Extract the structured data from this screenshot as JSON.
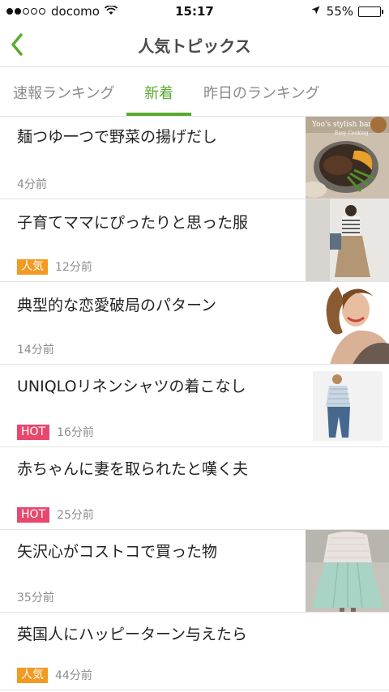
{
  "status_bar": {
    "carrier": "docomo",
    "time": "15:17",
    "battery": "55%",
    "battery_level": 0.55
  },
  "nav": {
    "title": "人気トピックス"
  },
  "tabs": [
    {
      "label": "速報ランキング",
      "active": false
    },
    {
      "label": "新着",
      "active": true
    },
    {
      "label": "昨日のランキング",
      "active": false
    }
  ],
  "items": [
    {
      "title": "麺つゆ一つで野菜の揚げだし",
      "badge": "",
      "time": "4分前",
      "thumb_text": {
        "line1": "Yoo's stylish bar",
        "line2": "Easy Cooking"
      }
    },
    {
      "title": "子育てママにぴったりと思った服",
      "badge": "人気",
      "time": "12分前"
    },
    {
      "title": "典型的な恋愛破局のパターン",
      "badge": "",
      "time": "14分前"
    },
    {
      "title": "UNIQLOリネンシャツの着こなし",
      "badge": "HOT",
      "time": "16分前"
    },
    {
      "title": "赤ちゃんに妻を取られたと嘆く夫",
      "badge": "HOT",
      "time": "25分前"
    },
    {
      "title": "矢沢心がコストコで買った物",
      "badge": "",
      "time": "35分前"
    },
    {
      "title": "英国人にハッピーターン与えたら",
      "badge": "人気",
      "time": "44分前"
    }
  ],
  "colors": {
    "accent": "#5aaa2c",
    "badge_ninki": "#f29a22",
    "badge_hot": "#e8486d"
  }
}
